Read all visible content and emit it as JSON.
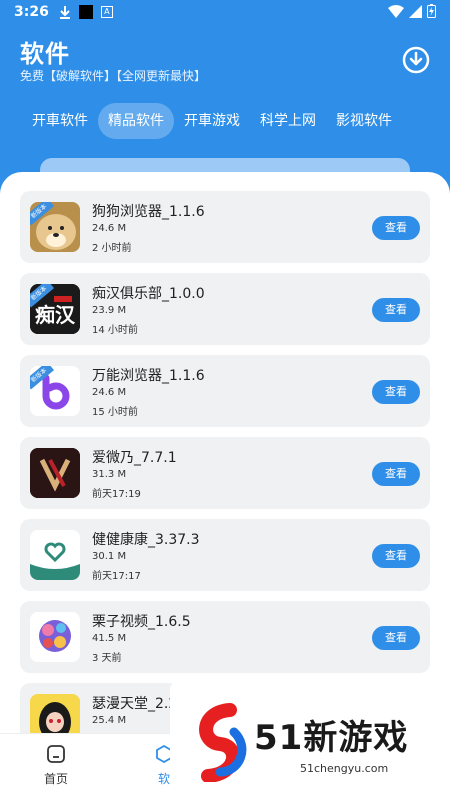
{
  "status_bar": {
    "time": "3:26",
    "download_icon": "download-arrow-icon",
    "box_icon_letter": "A"
  },
  "header": {
    "title": "软件",
    "subtitle": "免费【破解软件】【全网更新最快】",
    "download_icon": "download-circle-icon"
  },
  "tabs": [
    {
      "label": "开車软件",
      "active": false
    },
    {
      "label": "精品软件",
      "active": true
    },
    {
      "label": "开車游戏",
      "active": false
    },
    {
      "label": "科学上网",
      "active": false
    },
    {
      "label": "影视软件",
      "active": false
    }
  ],
  "apps": [
    {
      "name": "狗狗浏览器_1.1.6",
      "size": "24.6 M",
      "time": "2 小时前",
      "button": "查看",
      "badge": "新版本",
      "icon": "doge-icon"
    },
    {
      "name": "痴汉俱乐部_1.0.0",
      "size": "23.9 M",
      "time": "14 小时前",
      "button": "查看",
      "badge": "新版本",
      "icon": "chihan-icon"
    },
    {
      "name": "万能浏览器_1.1.6",
      "size": "24.6 M",
      "time": "15 小时前",
      "button": "查看",
      "badge": "新版本",
      "icon": "wanneng-icon"
    },
    {
      "name": "爱微乃_7.7.1",
      "size": "31.3 M",
      "time": "前天17:19",
      "button": "查看",
      "badge": "",
      "icon": "aiweinai-icon"
    },
    {
      "name": "健健康康_3.37.3",
      "size": "30.1 M",
      "time": "前天17:17",
      "button": "查看",
      "badge": "",
      "icon": "heart-icon"
    },
    {
      "name": "栗子视频_1.6.5",
      "size": "41.5 M",
      "time": "3 天前",
      "button": "查看",
      "badge": "",
      "icon": "lizi-icon"
    },
    {
      "name": "瑟漫天堂_2.2",
      "size": "25.4 M",
      "time": "",
      "button": "查看",
      "badge": "",
      "icon": "anime-girl-icon"
    }
  ],
  "bottom_nav": [
    {
      "label": "首页",
      "icon": "home-icon"
    },
    {
      "label": "软",
      "icon": "cube-icon"
    }
  ],
  "watermark": {
    "text": "51新游戏",
    "url": "51chengyu.com"
  },
  "colors": {
    "primary": "#2f8fe8",
    "card": "#f0f1f3",
    "button": "#2f8fe8"
  }
}
